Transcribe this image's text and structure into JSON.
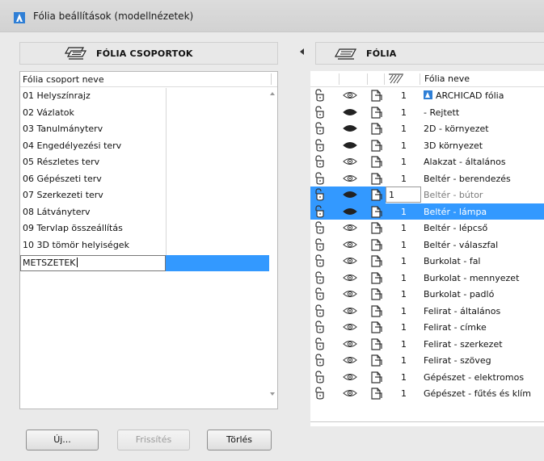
{
  "window": {
    "title": "Fólia beállítások (modellnézetek)"
  },
  "left_pane": {
    "header": "FÓLIA CSOPORTOK",
    "column_header": "Fólia csoport neve",
    "groups": [
      "01 Helyszínrajz",
      "02 Vázlatok",
      "03 Tanulmányterv",
      "04 Engedélyezési terv",
      "05 Részletes terv",
      "06 Gépészeti terv",
      "07 Szerkezeti terv",
      "08 Látványterv",
      "09 Tervlap összeállítás",
      "10 3D tömör helyiségek"
    ],
    "edit_value": "METSZETEK",
    "buttons": {
      "new": "Új...",
      "refresh": "Frissítés",
      "delete": "Törlés"
    }
  },
  "right_pane": {
    "header": "FÓLIA",
    "column_header": "Fólia neve",
    "layers": [
      {
        "num": "1",
        "name": "ARCHICAD fólia",
        "eye": "open",
        "state": "normal",
        "badge": true
      },
      {
        "num": "1",
        "name": "- Rejtett",
        "eye": "closed",
        "state": "normal"
      },
      {
        "num": "1",
        "name": "2D - környezet",
        "eye": "closed",
        "state": "normal"
      },
      {
        "num": "1",
        "name": "3D környezet",
        "eye": "closed",
        "state": "normal"
      },
      {
        "num": "1",
        "name": "Alakzat - általános",
        "eye": "open",
        "state": "normal"
      },
      {
        "num": "1",
        "name": "Beltér - berendezés",
        "eye": "open",
        "state": "normal"
      },
      {
        "num": "1",
        "name": "Beltér - bútor",
        "eye": "closed",
        "state": "editing"
      },
      {
        "num": "1",
        "name": "Beltér - lámpa",
        "eye": "closed",
        "state": "selected"
      },
      {
        "num": "1",
        "name": "Beltér - lépcső",
        "eye": "open",
        "state": "normal"
      },
      {
        "num": "1",
        "name": "Beltér - válaszfal",
        "eye": "open",
        "state": "normal"
      },
      {
        "num": "1",
        "name": "Burkolat - fal",
        "eye": "open",
        "state": "normal"
      },
      {
        "num": "1",
        "name": "Burkolat - mennyezet",
        "eye": "open",
        "state": "normal"
      },
      {
        "num": "1",
        "name": "Burkolat - padló",
        "eye": "open",
        "state": "normal"
      },
      {
        "num": "1",
        "name": "Felirat - általános",
        "eye": "open",
        "state": "normal"
      },
      {
        "num": "1",
        "name": "Felirat - címke",
        "eye": "open",
        "state": "normal"
      },
      {
        "num": "1",
        "name": "Felirat - szerkezet",
        "eye": "open",
        "state": "normal"
      },
      {
        "num": "1",
        "name": "Felirat - szöveg",
        "eye": "open",
        "state": "normal"
      },
      {
        "num": "1",
        "name": "Gépészet - elektromos",
        "eye": "open",
        "state": "normal"
      },
      {
        "num": "1",
        "name": "Gépészet - fűtés és klím",
        "eye": "open",
        "state": "normal"
      }
    ]
  },
  "colors": {
    "selection": "#3399ff",
    "archicad_blue": "#2f7fd6"
  }
}
